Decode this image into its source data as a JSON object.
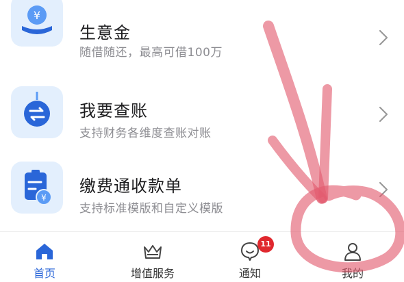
{
  "services": [
    {
      "title": "生意金",
      "subtitle": "随借随还，最高可借100万",
      "icon": "loan-yen-icon"
    },
    {
      "title": "我要查账",
      "subtitle": "支持财务各维度查账对账",
      "icon": "ledger-check-icon"
    },
    {
      "title": "缴费通收款单",
      "subtitle": "支持标准模版和自定义模版",
      "icon": "bill-receipt-icon"
    }
  ],
  "tabbar": {
    "tabs": [
      {
        "label": "首页",
        "icon": "home-icon",
        "active": true
      },
      {
        "label": "增值服务",
        "icon": "crown-icon",
        "active": false
      },
      {
        "label": "通知",
        "icon": "notification-icon",
        "active": false
      },
      {
        "label": "我的",
        "icon": "user-icon",
        "active": false
      }
    ],
    "notification_badge": "11"
  },
  "colors": {
    "accent": "#2a66d8",
    "tile_bg": "#e3effd",
    "badge": "#e0282e",
    "annotation": "#e25a6e"
  }
}
